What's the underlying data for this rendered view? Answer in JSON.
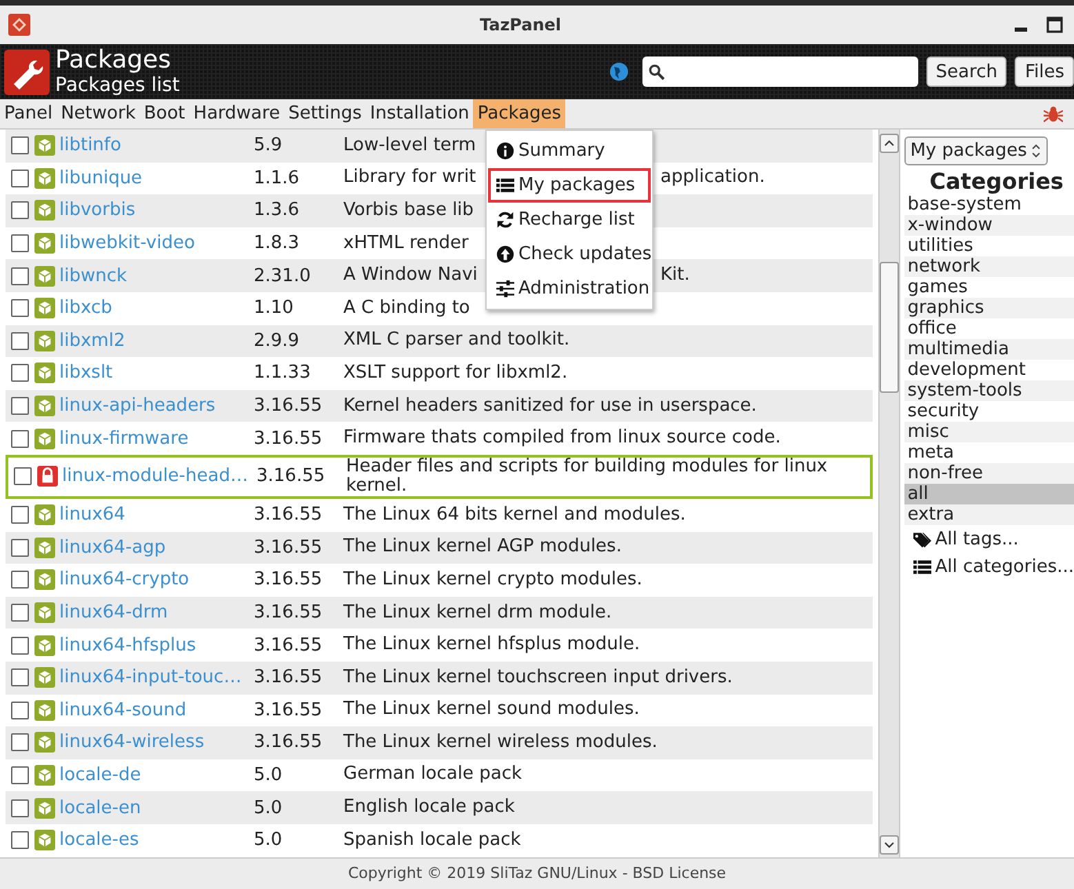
{
  "window": {
    "title": "TazPanel"
  },
  "header": {
    "title": "Packages",
    "subtitle": "Packages list",
    "buttons": [
      "Search",
      "Files"
    ]
  },
  "menu_bar": [
    {
      "label": "Panel",
      "selected": false
    },
    {
      "label": "Network",
      "selected": false
    },
    {
      "label": "Boot",
      "selected": false
    },
    {
      "label": "Hardware",
      "selected": false
    },
    {
      "label": "Settings",
      "selected": false
    },
    {
      "label": "Installation",
      "selected": false
    },
    {
      "label": "Packages",
      "selected": true
    }
  ],
  "dropdown": [
    {
      "label": "Summary",
      "selected": false
    },
    {
      "label": "My packages",
      "selected": true
    },
    {
      "label": "Recharge list",
      "selected": false
    },
    {
      "label": "Check updates",
      "selected": false
    },
    {
      "label": "Administration",
      "selected": false
    }
  ],
  "packages": [
    {
      "name": "libtinfo",
      "version": "5.9",
      "desc": "Low-level term",
      "kind": "package",
      "checked": false,
      "selected": false
    },
    {
      "name": "libunique",
      "version": "1.1.6",
      "desc": "Library for writ",
      "desc_after": "application.",
      "kind": "package",
      "checked": false,
      "selected": false
    },
    {
      "name": "libvorbis",
      "version": "1.3.6",
      "desc": "Vorbis base lib",
      "kind": "package",
      "checked": false,
      "selected": false
    },
    {
      "name": "libwebkit-video",
      "version": "1.8.3",
      "desc": "xHTML render",
      "kind": "package",
      "checked": false,
      "selected": false
    },
    {
      "name": "libwnck",
      "version": "2.31.0",
      "desc": "A Window Navi",
      "desc_after": "Kit.",
      "kind": "package",
      "checked": false,
      "selected": false
    },
    {
      "name": "libxcb",
      "version": "1.10",
      "desc": "A C binding to",
      "kind": "package",
      "checked": false,
      "selected": false
    },
    {
      "name": "libxml2",
      "version": "2.9.9",
      "desc": "XML C parser and toolkit.",
      "kind": "package",
      "checked": false,
      "selected": false
    },
    {
      "name": "libxslt",
      "version": "1.1.33",
      "desc": "XSLT support for libxml2.",
      "kind": "package",
      "checked": false,
      "selected": false
    },
    {
      "name": "linux-api-headers",
      "version": "3.16.55",
      "desc": "Kernel headers sanitized for use in userspace.",
      "kind": "package",
      "checked": false,
      "selected": false
    },
    {
      "name": "linux-firmware",
      "version": "3.16.55",
      "desc": "Firmware thats compiled from linux source code.",
      "kind": "package",
      "checked": false,
      "selected": false
    },
    {
      "name": "linux-module-head…",
      "version": "3.16.55",
      "desc": "Header files and scripts for building modules for linux kernel.",
      "kind": "locked",
      "checked": false,
      "selected": true
    },
    {
      "name": "linux64",
      "version": "3.16.55",
      "desc": "The Linux 64 bits kernel and modules.",
      "kind": "package",
      "checked": false,
      "selected": false
    },
    {
      "name": "linux64-agp",
      "version": "3.16.55",
      "desc": "The Linux kernel AGP modules.",
      "kind": "package",
      "checked": false,
      "selected": false
    },
    {
      "name": "linux64-crypto",
      "version": "3.16.55",
      "desc": "The Linux kernel crypto modules.",
      "kind": "package",
      "checked": false,
      "selected": false
    },
    {
      "name": "linux64-drm",
      "version": "3.16.55",
      "desc": "The Linux kernel drm module.",
      "kind": "package",
      "checked": false,
      "selected": false
    },
    {
      "name": "linux64-hfsplus",
      "version": "3.16.55",
      "desc": "The Linux kernel hfsplus module.",
      "kind": "package",
      "checked": false,
      "selected": false
    },
    {
      "name": "linux64-input-touc…",
      "version": "3.16.55",
      "desc": "The Linux kernel touchscreen input drivers.",
      "kind": "package",
      "checked": false,
      "selected": false
    },
    {
      "name": "linux64-sound",
      "version": "3.16.55",
      "desc": "The Linux kernel sound modules.",
      "kind": "package",
      "checked": false,
      "selected": false
    },
    {
      "name": "linux64-wireless",
      "version": "3.16.55",
      "desc": "The Linux kernel wireless modules.",
      "kind": "package",
      "checked": false,
      "selected": false
    },
    {
      "name": "locale-de",
      "version": "5.0",
      "desc": "German locale pack",
      "kind": "package",
      "checked": false,
      "selected": false
    },
    {
      "name": "locale-en",
      "version": "5.0",
      "desc": "English locale pack",
      "kind": "package",
      "checked": false,
      "selected": false
    },
    {
      "name": "locale-es",
      "version": "5.0",
      "desc": "Spanish locale pack",
      "kind": "package",
      "checked": false,
      "selected": false
    }
  ],
  "sidebar": {
    "select": "My packages",
    "heading": "Categories",
    "categories": [
      {
        "label": "base-system",
        "selected": false
      },
      {
        "label": "x-window",
        "selected": false
      },
      {
        "label": "utilities",
        "selected": false
      },
      {
        "label": "network",
        "selected": false
      },
      {
        "label": "games",
        "selected": false
      },
      {
        "label": "graphics",
        "selected": false
      },
      {
        "label": "office",
        "selected": false
      },
      {
        "label": "multimedia",
        "selected": false
      },
      {
        "label": "development",
        "selected": false
      },
      {
        "label": "system-tools",
        "selected": false
      },
      {
        "label": "security",
        "selected": false
      },
      {
        "label": "misc",
        "selected": false
      },
      {
        "label": "meta",
        "selected": false
      },
      {
        "label": "non-free",
        "selected": false
      },
      {
        "label": "all",
        "selected": true
      },
      {
        "label": "extra",
        "selected": false
      }
    ],
    "links": [
      {
        "label": "All tags..."
      },
      {
        "label": "All categories..."
      }
    ]
  },
  "footer": "Copyright © 2019 SliTaz GNU/Linux - BSD License"
}
